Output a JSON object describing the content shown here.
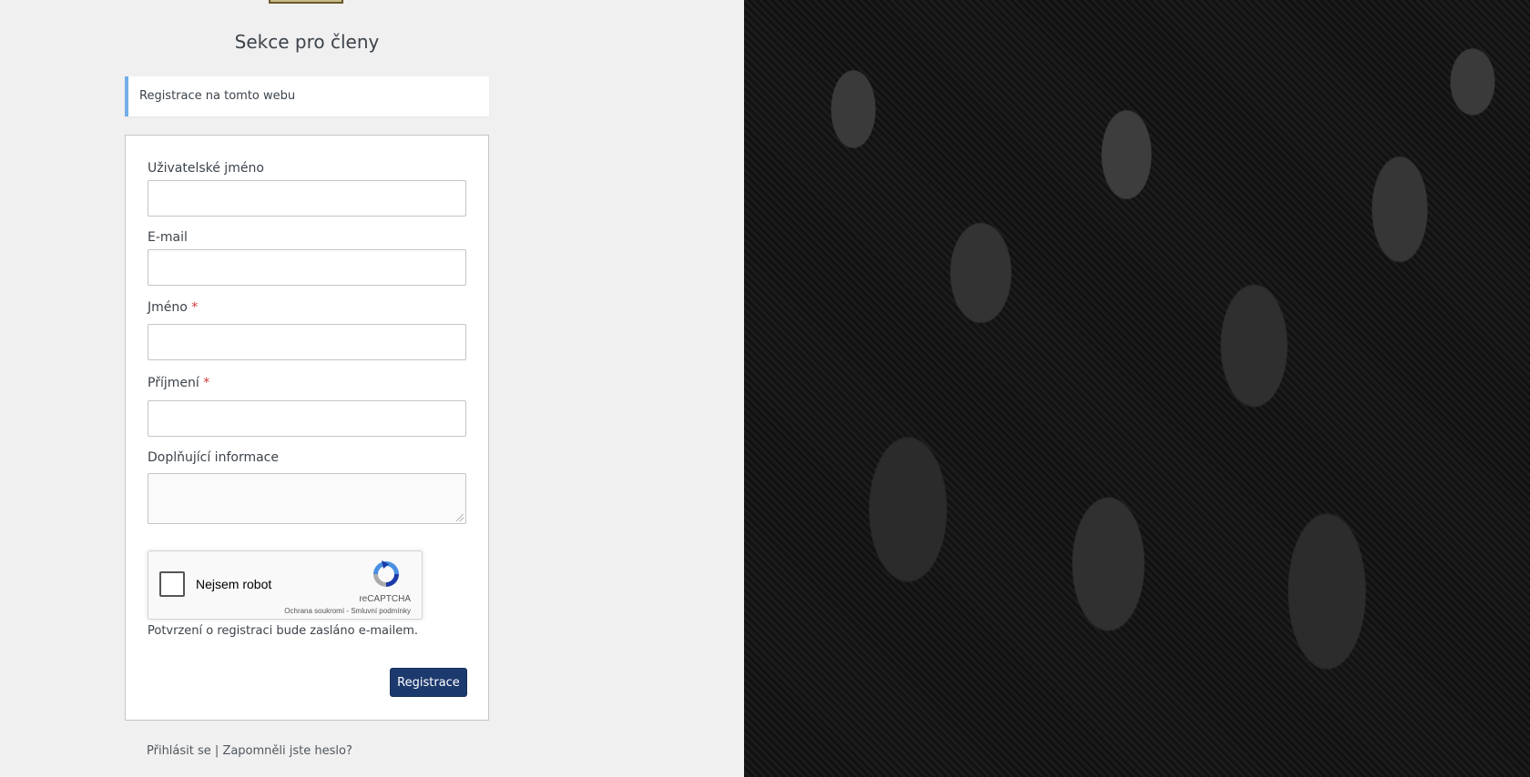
{
  "header": {
    "title": "Sekce pro členy"
  },
  "notice": {
    "text": "Registrace na tomto webu"
  },
  "form": {
    "username_label": "Uživatelské jméno",
    "email_label": "E-mail",
    "first_name_label": "Jméno",
    "last_name_label": "Příjmení",
    "required_mark": "*",
    "info_label": "Doplňující informace",
    "confirmation_note": "Potvrzení o registraci bude zasláno e-mailem.",
    "submit_label": "Registrace"
  },
  "recaptcha": {
    "checkbox_label": "Nejsem robot",
    "brand": "reCAPTCHA",
    "privacy": "Ochrana soukromí",
    "separator": " - ",
    "terms": "Smluvní podmínky",
    "icon": "recaptcha-logo-icon"
  },
  "footer_nav": {
    "login": "Přihlásit se",
    "separator": " | ",
    "forgot": "Zapomněli jste heslo?"
  },
  "colors": {
    "accent": "#72aee6",
    "button": "#1d3a6e",
    "required": "#d63638",
    "background": "#f0f0f0"
  }
}
